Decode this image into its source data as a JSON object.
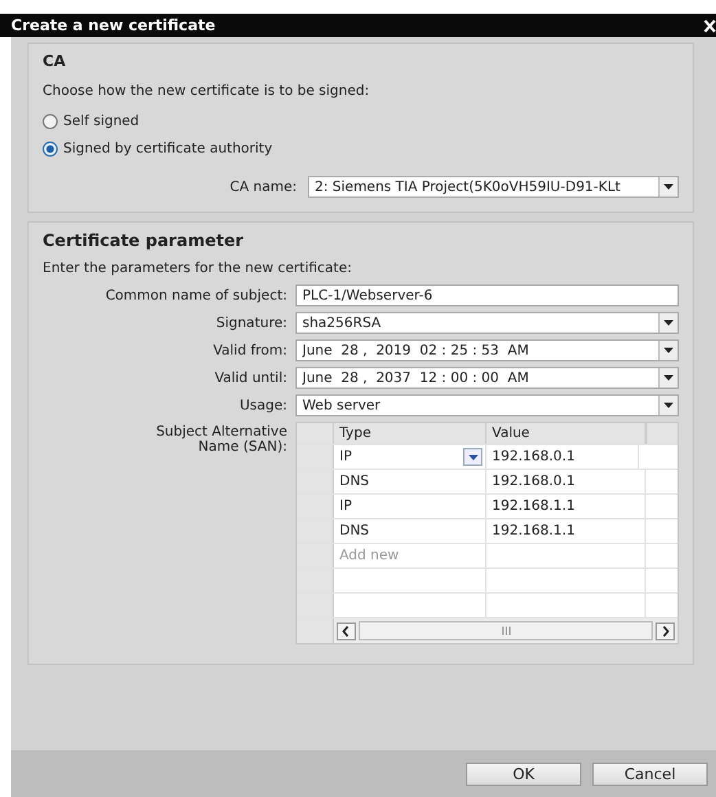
{
  "window": {
    "title": "Create a new certificate"
  },
  "ca": {
    "heading": "CA",
    "prompt": "Choose how the new certificate is to be signed:",
    "options": [
      {
        "label": "Self signed",
        "selected": false
      },
      {
        "label": "Signed by certificate authority",
        "selected": true
      }
    ],
    "ca_name": {
      "label": "CA name:",
      "value": "2: Siemens TIA Project(5K0oVH59IU-D91-KLt"
    }
  },
  "certificate": {
    "heading": "Certificate parameter",
    "prompt": "Enter the parameters for the new certificate:",
    "fields": [
      {
        "label": "Common name of subject:",
        "value": "PLC-1/Webserver-6",
        "kind": "text"
      },
      {
        "label": "Signature:",
        "value": "sha256RSA",
        "kind": "dropdown"
      },
      {
        "label": "Valid from:",
        "value": "June  28 ,  2019  02 : 25 : 53  AM",
        "kind": "dropdown"
      },
      {
        "label": "Valid until:",
        "value": "June  28 ,  2037  12 : 00 : 00  AM",
        "kind": "dropdown"
      },
      {
        "label": "Usage:",
        "value": "Web server",
        "kind": "dropdown"
      }
    ],
    "san": {
      "label": "Subject Alternative Name (SAN):",
      "columns": [
        "Type",
        "Value"
      ],
      "rows": [
        {
          "type": "IP",
          "value": "192.168.0.1",
          "editing": true
        },
        {
          "type": "DNS",
          "value": "192.168.0.1",
          "editing": false
        },
        {
          "type": "IP",
          "value": "192.168.1.1",
          "editing": false
        },
        {
          "type": "DNS",
          "value": "192.168.1.1",
          "editing": false
        }
      ],
      "add_new": "Add new"
    }
  },
  "buttons": [
    "OK",
    "Cancel"
  ]
}
